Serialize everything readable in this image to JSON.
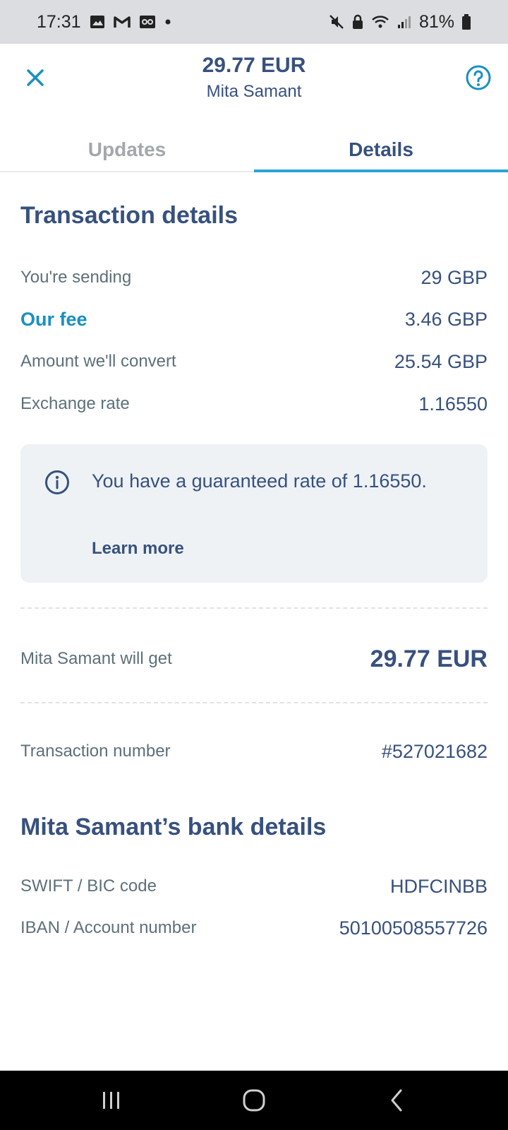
{
  "status_bar": {
    "time": "17:31",
    "battery": "81%",
    "left_icons": [
      "gallery-icon",
      "gmail-icon",
      "voicemail-icon",
      "dot-icon"
    ],
    "right_icons": [
      "mute-icon",
      "lock-icon",
      "wifi-icon",
      "signal-icon",
      "battery-icon"
    ]
  },
  "header": {
    "amount": "29.77 EUR",
    "recipient": "Mita Samant"
  },
  "tabs": [
    {
      "label": "Updates",
      "active": false
    },
    {
      "label": "Details",
      "active": true
    }
  ],
  "transaction": {
    "title": "Transaction details",
    "rows": [
      {
        "label": "You're sending",
        "value": "29 GBP"
      },
      {
        "label": "Our fee",
        "value": "3.46 GBP"
      },
      {
        "label": "Amount we'll convert",
        "value": "25.54 GBP"
      },
      {
        "label": "Exchange rate",
        "value": "1.16550"
      }
    ],
    "info": {
      "text": "You have a guaranteed rate of 1.16550.",
      "link": "Learn more"
    },
    "recipient_gets_label": "Mita Samant will get",
    "recipient_gets_value": "29.77 EUR",
    "number_label": "Transaction number",
    "number_value": "#527021682"
  },
  "bank": {
    "title": "Mita Samant’s bank details",
    "rows": [
      {
        "label": "SWIFT / BIC code",
        "value": "HDFCINBB"
      },
      {
        "label": "IBAN / Account number",
        "value": "50100508557726"
      }
    ]
  },
  "colors": {
    "primary": "#37517e",
    "accent": "#2aa5d5",
    "fee": "#1a8fc2",
    "muted": "#5d7079",
    "info_bg": "#eef2f5"
  }
}
